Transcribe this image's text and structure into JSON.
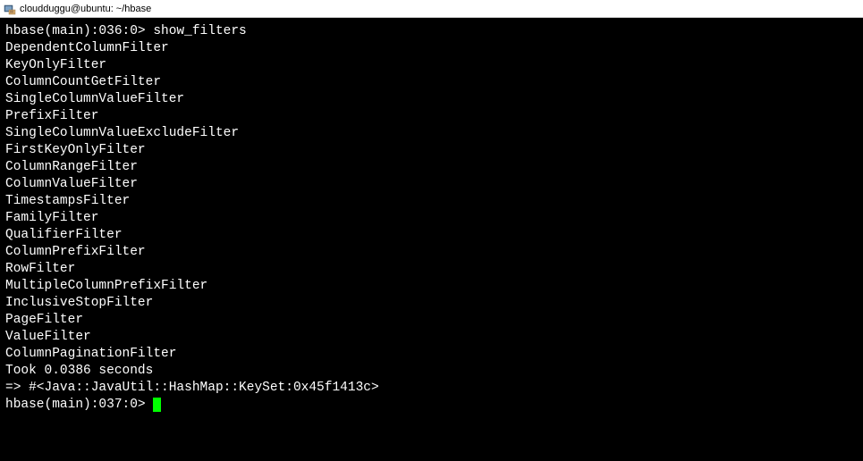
{
  "window": {
    "title": "cloudduggu@ubuntu: ~/hbase"
  },
  "terminal": {
    "prompt1": "hbase(main):036:0> ",
    "command1": "show_filters",
    "output_lines": [
      "DependentColumnFilter",
      "KeyOnlyFilter",
      "ColumnCountGetFilter",
      "SingleColumnValueFilter",
      "PrefixFilter",
      "SingleColumnValueExcludeFilter",
      "FirstKeyOnlyFilter",
      "ColumnRangeFilter",
      "ColumnValueFilter",
      "TimestampsFilter",
      "FamilyFilter",
      "QualifierFilter",
      "ColumnPrefixFilter",
      "RowFilter",
      "MultipleColumnPrefixFilter",
      "InclusiveStopFilter",
      "PageFilter",
      "ValueFilter",
      "ColumnPaginationFilter"
    ],
    "timing": "Took 0.0386 seconds",
    "result": "=> #<Java::JavaUtil::HashMap::KeySet:0x45f1413c>",
    "prompt2": "hbase(main):037:0> "
  }
}
